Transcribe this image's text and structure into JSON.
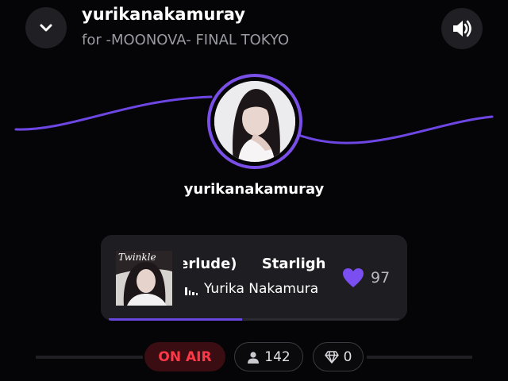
{
  "header": {
    "title": "yurikanakamuray",
    "subtitle": "for -MOONOVA- FINAL TOKYO",
    "collapse_icon": "chevron-down-icon",
    "sound_icon": "speaker-volume-icon"
  },
  "host": {
    "name": "yurikanakamuray"
  },
  "now_playing": {
    "title_scroll": "Interlude)     Starligh",
    "artist": "Yurika Nakamura",
    "cover_text": "Twinkle",
    "like_count": "97",
    "progress": 0.46
  },
  "status": {
    "onair_label": "ON AIR",
    "listener_count": "142",
    "gem_count": "0"
  },
  "colors": {
    "accent": "#7a4fe8",
    "onair_red": "#ff3848"
  }
}
